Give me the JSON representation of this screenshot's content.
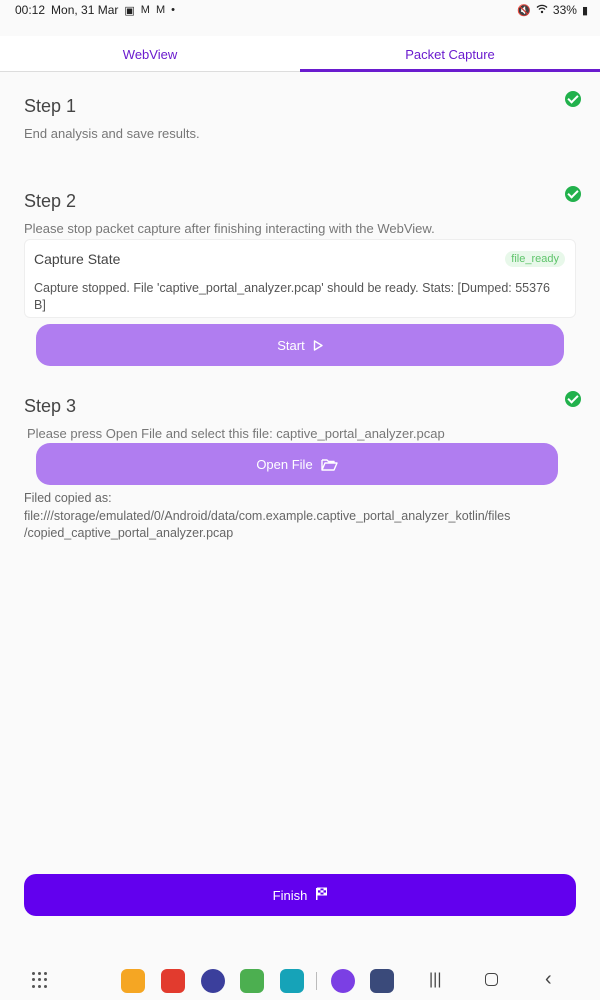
{
  "status": {
    "time": "00:12",
    "date": "Mon, 31 Mar",
    "battery": "33%"
  },
  "tabs": [
    {
      "label": "WebView"
    },
    {
      "label": "Packet Capture",
      "active": true
    }
  ],
  "step1": {
    "title": "Step 1",
    "desc": "End analysis and save results."
  },
  "step2": {
    "title": "Step 2",
    "desc": "Please stop packet capture after finishing interacting with the WebView.",
    "card": {
      "title": "Capture State",
      "badge": "file_ready",
      "text": "Capture stopped. File 'captive_portal_analyzer.pcap' should be ready. Stats: [Dumped: 55376 B]"
    },
    "button": "Start"
  },
  "step3": {
    "title": "Step 3",
    "desc": "Please press Open File and select this file: captive_portal_analyzer.pcap",
    "button": "Open File"
  },
  "copied": {
    "line1": "Filed copied as:",
    "line2": "file:///storage/emulated/0/Android/data/com.example.captive_portal_analyzer_kotlin/files",
    "line3": "/copied_captive_portal_analyzer.pcap"
  },
  "finish": {
    "label": "Finish"
  },
  "icons": {
    "check": "check-circle-icon",
    "play": "play-icon",
    "folder": "folder-open-icon",
    "flag": "checkered-flag-icon"
  },
  "colors": {
    "primary": "#6200ee",
    "button": "#b07df0",
    "success": "#22b14c",
    "accent": "#6a1bce"
  }
}
